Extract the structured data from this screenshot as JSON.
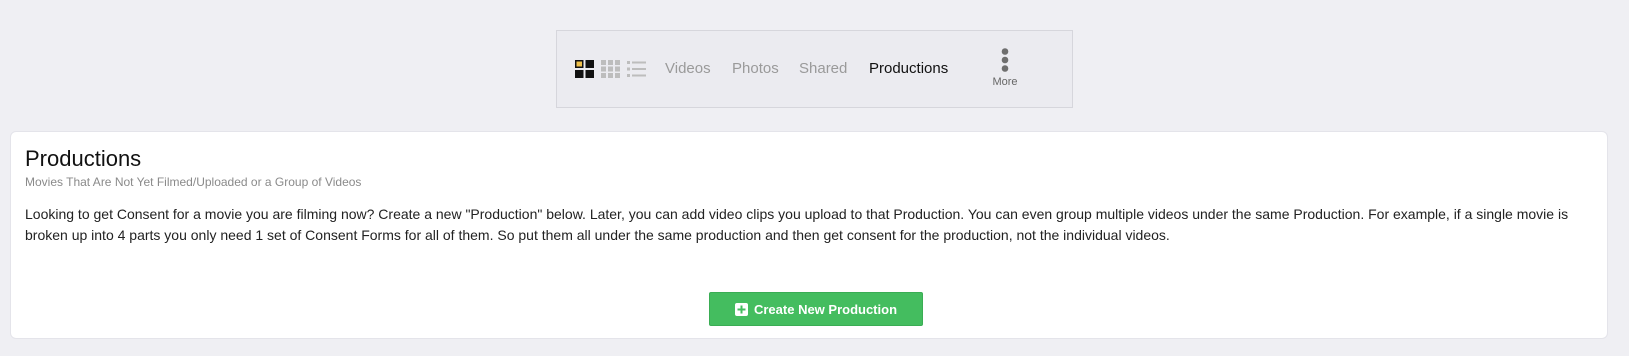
{
  "toolbar": {
    "view_icons": [
      "large-grid-icon",
      "small-grid-icon",
      "list-icon"
    ],
    "tabs": [
      {
        "label": "Videos",
        "active": false
      },
      {
        "label": "Photos",
        "active": false
      },
      {
        "label": "Shared",
        "active": false
      },
      {
        "label": "Productions",
        "active": true
      }
    ],
    "more": {
      "label": "More",
      "icon": "vertical-dots-icon"
    }
  },
  "card": {
    "title": "Productions",
    "subtitle": "Movies That Are Not Yet Filmed/Uploaded or a Group of Videos",
    "description": "Looking to get Consent for a movie you are filming now? Create a new \"Production\" below. Later, you can add video clips you upload to that Production. You can even group multiple videos under the same Production. For example, if a single movie is broken up into 4 parts you only need 1 set of Consent Forms for all of them. So put them all under the same production and then get consent for the production, not the individual videos.",
    "create_button": {
      "label": "Create New Production",
      "icon": "plus-square-icon"
    }
  },
  "colors": {
    "page_background": "#efeff3",
    "button_green": "#44bd5f",
    "active_tab": "#111111",
    "inactive_tab": "#9a9a9a"
  }
}
